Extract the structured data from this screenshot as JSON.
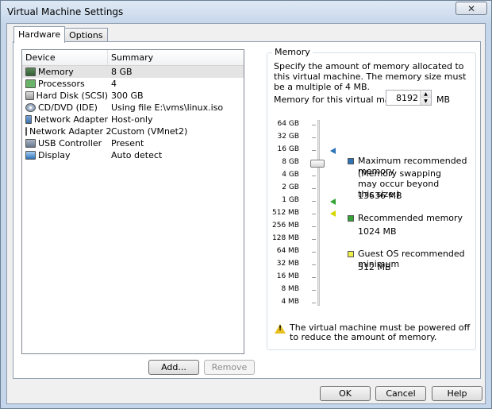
{
  "window": {
    "title": "Virtual Machine Settings",
    "close_glyph": "✕"
  },
  "tabs": [
    {
      "label": "Hardware",
      "active": true
    },
    {
      "label": "Options",
      "active": false
    }
  ],
  "device_list": {
    "columns": {
      "device": "Device",
      "summary": "Summary"
    },
    "rows": [
      {
        "device": "Memory",
        "summary": "8 GB",
        "icon": "memory-icon",
        "selected": true
      },
      {
        "device": "Processors",
        "summary": "4",
        "icon": "processor-icon"
      },
      {
        "device": "Hard Disk (SCSI)",
        "summary": "300 GB",
        "icon": "hard-disk-icon"
      },
      {
        "device": "CD/DVD (IDE)",
        "summary": "Using file E:\\vms\\linux.iso",
        "icon": "cd-dvd-icon"
      },
      {
        "device": "Network Adapter",
        "summary": "Host-only",
        "icon": "network-adapter-icon"
      },
      {
        "device": "Network Adapter 2",
        "summary": "Custom (VMnet2)",
        "icon": "network-adapter-icon"
      },
      {
        "device": "USB Controller",
        "summary": "Present",
        "icon": "usb-icon"
      },
      {
        "device": "Display",
        "summary": "Auto detect",
        "icon": "display-icon"
      }
    ],
    "add_label": "Add...",
    "remove_label": "Remove"
  },
  "memory": {
    "group_label": "Memory",
    "description": "Specify the amount of memory allocated to this virtual machine. The memory size must be a multiple of 4 MB.",
    "field_label": "Memory for this virtual machine:",
    "value": "8192",
    "unit": "MB",
    "scale": [
      "64 GB",
      "32 GB",
      "16 GB",
      "8 GB",
      "4 GB",
      "2 GB",
      "1 GB",
      "512 MB",
      "256 MB",
      "128 MB",
      "64 MB",
      "32 MB",
      "16 MB",
      "8 MB",
      "4 MB"
    ],
    "legend": {
      "max_label": "Maximum recommended memory",
      "max_note": "(Memory swapping may occur beyond this size.)",
      "max_value": "13636 MB",
      "rec_label": "Recommended memory",
      "rec_value": "1024 MB",
      "min_label": "Guest OS recommended minimum",
      "min_value": "512 MB"
    },
    "colors": {
      "max": "#2d73b8",
      "recommended": "#35a335",
      "minimum": "#d6d600"
    },
    "warning": "The virtual machine must be powered off to reduce the amount of memory."
  },
  "footer": {
    "ok": "OK",
    "cancel": "Cancel",
    "help": "Help"
  }
}
